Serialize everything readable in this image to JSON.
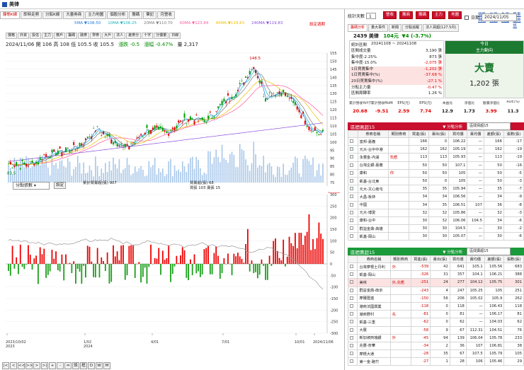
{
  "app": {
    "title": "美律"
  },
  "toolbar": {
    "tabs": [
      "靜態K線",
      "即時走勢",
      "分鉛K線",
      "大量券商",
      "主力地圖",
      "個股分析",
      "籌碼",
      "筆記",
      "月營收"
    ],
    "active": 0
  },
  "chart_header": {
    "ma": [
      {
        "label": "5MA",
        "value": "108.50",
        "color": "#1f7ae0"
      },
      {
        "label": "10MA",
        "value": "106.25",
        "color": "#19b4c2"
      },
      {
        "label": "20MA",
        "value": "110.70",
        "color": "#7a7a7a"
      },
      {
        "label": "60MA",
        "value": "123.84",
        "color": "#ff5aa0"
      },
      {
        "label": "40MA",
        "value": "118.83",
        "color": "#f0c000"
      },
      {
        "label": "240MA",
        "value": "119.83",
        "color": "#8a4fe0"
      }
    ],
    "fx_link": "設定週期",
    "sub_tabs": [
      "價格",
      "外資",
      "投信",
      "主力",
      "散戶",
      "籌碼",
      "融券",
      "學券",
      "大戶",
      "法人",
      "差券分",
      "十字",
      "分價量",
      "日線"
    ],
    "ohlc": "2024/11/06 開 106 高 108 低 105.5 收 105.5",
    "change": "漲跌 -0.5",
    "pct": "漲幅 -0.47%",
    "vol": "量 2,317"
  },
  "price_axis": [
    "155",
    "150",
    "145",
    "140",
    "135",
    "130",
    "125",
    "120",
    "115",
    "110",
    "105",
    "100",
    "95",
    "90",
    "85",
    "80",
    "75"
  ],
  "peak_label": "148.5",
  "low_label": "83.5",
  "indicator": {
    "dropdown": "分點張數",
    "btn": "設定",
    "legend1": "累計買賣超(張) 907",
    "legend2a": "買賣超(張) 68",
    "legend2b": "買張 103 賣張 15",
    "last": "329.91"
  },
  "indicator_axis": [
    "300",
    "250",
    "200",
    "150",
    "100",
    "50",
    "0",
    "-50",
    "-100",
    "-150",
    "-200",
    "-250",
    "-300"
  ],
  "date_axis": [
    "2023/10/02\n2023",
    "1/02\n2024",
    "4/01",
    "7/01",
    "10/01",
    "2024/11/06"
  ],
  "bottom_tools": [
    "|<",
    "<",
    "<<",
    ">>",
    ">",
    ">|",
    "+",
    "-",
    "⇔",
    "設",
    "框",
    "D",
    "W",
    "M"
  ],
  "right_panel": {
    "top_tabs": [
      "統計天數",
      "1",
      "營收",
      "籌商",
      "籌碼",
      "主力",
      "地圖"
    ],
    "links": [
      "個股資訊",
      "外資持股",
      "外資賣超",
      "股東會資訊"
    ],
    "date_label": "日期",
    "date_value": "2024/11/05",
    "sub_tabs": [
      "籌碼分析",
      "量大事件",
      "新聞",
      "分點追蹤",
      "法人買超(127.5月)"
    ],
    "stock": "2439 美律",
    "price": "104元",
    "change": "▼4 (-3.7%)",
    "stats_title": "統計區間",
    "stats_range": "20241108 ~ 20241108",
    "stats": [
      [
        "區間成交量",
        "3,190 張"
      ],
      [
        "集中度-2.25%",
        "873 張"
      ],
      [
        "集中度-15.0%",
        "-2,075 張"
      ],
      [
        "1日買賣集中",
        "-1,202 張"
      ],
      [
        "1日買賣集中(%)",
        "-37.68 %"
      ],
      [
        "20日買賣集中(%)",
        "-27.1 %"
      ],
      [
        "分點主力量",
        "-0.47 %"
      ],
      [
        "區間周轉率",
        "1.26 %"
      ]
    ],
    "today_label": "今日",
    "today_sub": "主力動向",
    "today_main": "大賣",
    "today_val": "1,202 張",
    "metrics_h": [
      "累計營收YoY(%)",
      "累計營收MoM(%)",
      "EPS(元)",
      "EPS(元)",
      "本益比",
      "淨值比",
      "股價淨值比",
      "ROE(%)"
    ],
    "metrics_v": [
      "20.68",
      "-9.51",
      "2.59",
      "7.74",
      "12.9",
      "1.73",
      "3.99",
      "11.3"
    ]
  },
  "buy": {
    "title": "區間買超15",
    "tag": "▼ 分點分析",
    "sel": "區間買超15",
    "cols": [
      "",
      "券商名稱",
      "類別券商",
      "買進(張)",
      "賣出(張)",
      "買均價",
      "賣均價",
      "差額(張)",
      "張數(張)"
    ],
    "rows": [
      [
        "",
        "富邦-嘉義",
        "",
        "166",
        "0",
        "106.22",
        "—",
        "166",
        "-17"
      ],
      [
        "✓",
        "元大-台中中港",
        "",
        "162",
        "162",
        "105.19",
        "—",
        "162",
        "-19"
      ],
      [
        "✓",
        "永豐金-內湖",
        "乳晤",
        "113",
        "113",
        "105.93",
        "—",
        "113",
        "-19"
      ],
      [
        "",
        "台灣企銀-嘉義",
        "",
        "50",
        "50",
        "107.1",
        "—",
        "50",
        "-16"
      ],
      [
        "",
        "康和",
        "你",
        "50",
        "50",
        "105",
        "—",
        "50",
        "-5"
      ],
      [
        "",
        "凱基-台北東",
        "",
        "50",
        "0",
        "105",
        "—",
        "50",
        "-3"
      ],
      [
        "✓",
        "元大-文心南屯",
        "",
        "35",
        "35",
        "105.94",
        "—",
        "35",
        "-7"
      ],
      [
        "",
        "大昌-板林",
        "",
        "34",
        "34",
        "106.56",
        "—",
        "34",
        "-9"
      ],
      [
        "",
        "中國",
        "",
        "34",
        "35",
        "106.51",
        "107",
        "36",
        "-8"
      ],
      [
        "",
        "元大-博愛",
        "",
        "32",
        "32",
        "105.86",
        "—",
        "32",
        "-3"
      ],
      [
        "",
        "康和-台中",
        "",
        "30",
        "32",
        "106.06",
        "104.5",
        "34",
        "-6"
      ],
      [
        "",
        "群益金鼎-高雄",
        "",
        "30",
        "30",
        "104.5",
        "—",
        "30",
        "-2"
      ],
      [
        "",
        "凱基-岡山",
        "",
        "30",
        "30",
        "105.07",
        "—",
        "30",
        "-6"
      ]
    ]
  },
  "sell": {
    "title": "區間賣超15",
    "tag": "▼ 分點分析",
    "sel": "區間賣超15",
    "cols": [
      "",
      "券商名稱",
      "類別券商",
      "買進(張)",
      "賣出(張)",
      "買均價",
      "賣均價",
      "差額(張)",
      "張數(張)"
    ],
    "rows": [
      [
        "",
        "台灣摩根士丹利",
        "外",
        "-539",
        "42",
        "641",
        "105.1",
        "105.56",
        "683",
        "93"
      ],
      [
        "",
        "凱基-岡山",
        "",
        "-326",
        "31",
        "357",
        "104.1",
        "106.21",
        "388",
        "78"
      ],
      [
        "",
        "美林",
        "外,先晤",
        "-251",
        "24",
        "277",
        "104.12",
        "105.75",
        "301",
        "48"
      ],
      [
        "",
        "群益金鼎-南京",
        "",
        "-243",
        "4",
        "247",
        "105.25",
        "105",
        "251",
        "24"
      ],
      [
        "",
        "摩爾匯盛",
        "",
        "-150",
        "56",
        "206",
        "105.02",
        "105.9",
        "262",
        "33"
      ],
      [
        "",
        "港商法國興業",
        "",
        "-118",
        "0",
        "118",
        "—",
        "106.43",
        "118",
        "29"
      ],
      [
        "",
        "港商野村",
        "先",
        "-81",
        "0",
        "81",
        "—",
        "106.17",
        "81",
        "18"
      ],
      [
        "",
        "凱基-三重",
        "",
        "-62",
        "0",
        "62",
        "—",
        "104.03",
        "62",
        "-1"
      ],
      [
        "",
        "大展",
        "",
        "-58",
        "9",
        "67",
        "112.31",
        "104.51",
        "76",
        "-6"
      ],
      [
        "",
        "新加坡商瑞銀",
        "外",
        "-45",
        "94",
        "139",
        "106.04",
        "105.78",
        "233",
        "6"
      ],
      [
        "",
        "兆豐-奈華",
        "",
        "-34",
        "2",
        "36",
        "107",
        "106.81",
        "38",
        "10"
      ],
      [
        "",
        "摩根大通",
        "",
        "-28",
        "35",
        "67",
        "107.5",
        "105.79",
        "105",
        "4"
      ],
      [
        "",
        "第一金-路竹",
        "",
        "-27",
        "1",
        "28",
        "106",
        "105.46",
        "29",
        "4"
      ]
    ]
  }
}
